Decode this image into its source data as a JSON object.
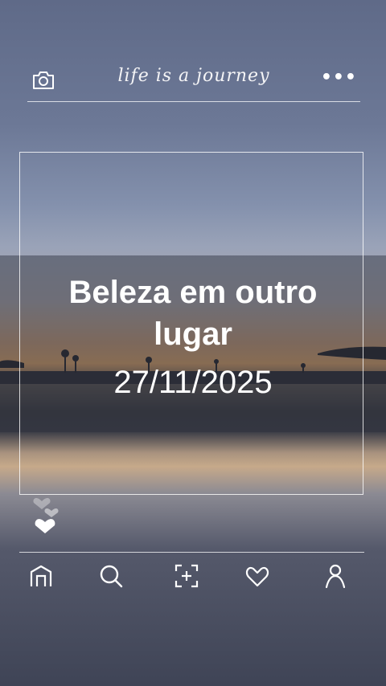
{
  "header": {
    "title": "life is a journey",
    "menu_label": "•••"
  },
  "post": {
    "caption_line1": "Beleza em outro",
    "caption_line2": "lugar",
    "date": "27/11/2025"
  },
  "icons": {
    "camera": "camera-icon",
    "more": "more-dots-icon",
    "heart": "heart-icon",
    "home": "home-icon",
    "search": "search-icon",
    "add": "add-post-icon",
    "likes": "heart-outline-icon",
    "profile": "profile-icon"
  },
  "colors": {
    "sky_top": "#5f6a88",
    "sunset": "#d6a068",
    "foreground": "#ffffff"
  }
}
